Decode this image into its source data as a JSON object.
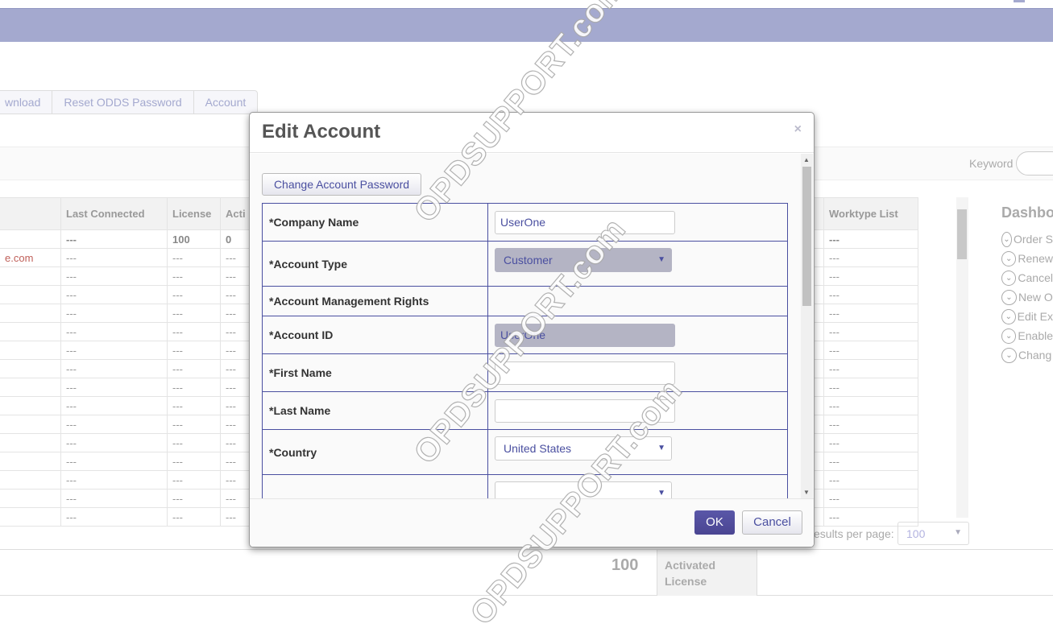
{
  "tabs": [
    "wnload",
    "Reset ODDS Password",
    "Account"
  ],
  "filter": {
    "keyword_label": "Keyword",
    "keyword_value": ""
  },
  "table": {
    "left_headers": [
      "",
      "Last Connected",
      "License",
      "Acti"
    ],
    "right_headers": [
      "",
      "Worktype List"
    ],
    "first_row": {
      "left": [
        "",
        "---",
        "100",
        "0"
      ],
      "right": [
        "",
        "---"
      ]
    },
    "second_row_email": "e.com",
    "empty": "---",
    "row_count": 16
  },
  "dashboard": {
    "title": "Dashbo",
    "items": [
      "Order S",
      "Renew",
      "Cancel",
      "New O",
      "Edit Ex",
      "Enable",
      "Chang"
    ]
  },
  "pagination": {
    "label": "esults per page:",
    "value": "100"
  },
  "footer": {
    "value": "100",
    "label": "Activated License"
  },
  "modal": {
    "title": "Edit Account",
    "close": "×",
    "change_password": "Change Account Password",
    "fields": [
      {
        "label": "*Company Name",
        "value": "UserOne"
      },
      {
        "label": "*Account Type",
        "value": "Customer"
      },
      {
        "label": "*Account Management Rights",
        "value": ""
      },
      {
        "label": "*Account ID",
        "value": "UserOne"
      },
      {
        "label": "*First Name",
        "value": ""
      },
      {
        "label": "*Last Name",
        "value": ""
      },
      {
        "label": "*Country",
        "value": "United States"
      },
      {
        "label": "",
        "value": ""
      }
    ],
    "ok": "OK",
    "cancel": "Cancel"
  },
  "watermark": "OPDSUPPORT.com",
  "colors": {
    "header": "#a4a9cf",
    "accent": "#4a4fa0",
    "primary_button": "#524ea0"
  }
}
